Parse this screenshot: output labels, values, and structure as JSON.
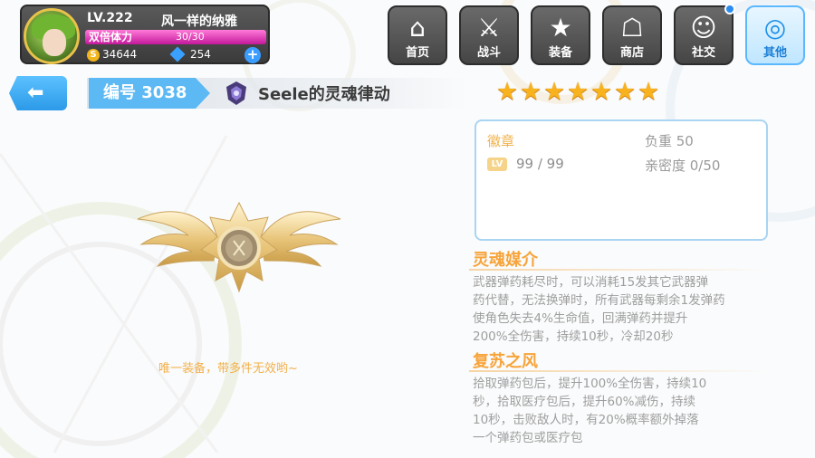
{
  "player": {
    "level": "LV.222",
    "name": "风一样的纳雅",
    "stamina_label": "双倍体力",
    "stamina_value": "30/30",
    "stamina_fraction": 1.0,
    "coins": "34644",
    "coin_symbol": "S",
    "gems": "254"
  },
  "nav": [
    {
      "label": "首页",
      "icon": "home-icon"
    },
    {
      "label": "战斗",
      "icon": "battle-icon"
    },
    {
      "label": "装备",
      "icon": "equipment-icon"
    },
    {
      "label": "商店",
      "icon": "shop-icon"
    },
    {
      "label": "社交",
      "icon": "social-icon"
    },
    {
      "label": "其他",
      "icon": "other-icon"
    }
  ],
  "header": {
    "index_label": "编号 3038",
    "item_name": "Seele的灵魂律动",
    "star_count": 7
  },
  "info": {
    "category": "徽章",
    "load": "负重 50",
    "lv_tag": "LV",
    "level": "99 / 99",
    "intimacy": "亲密度 0/50"
  },
  "skills": [
    {
      "title": "灵魂媒介",
      "lines": [
        "武器弹药耗尽时，可以消耗15发其它武器弹",
        "药代替，无法换弹时，所有武器每剩余1发弹药",
        "使角色失去4%生命值，回满弹药并提升",
        "200%全伤害，持续10秒，冷却20秒"
      ]
    },
    {
      "title": "复苏之风",
      "lines": [
        "拾取弹药包后，提升100%全伤害，持续10",
        "秒，拾取医疗包后，提升60%减伤，持续",
        "10秒，击败敌人时，有20%概率额外掉落",
        "一个弹药包或医疗包"
      ]
    }
  ],
  "note": "唯一装备，带多件无效哟~",
  "colors": {
    "accent_blue": "#5cb9f4",
    "star": "#f7b21d",
    "skill_title": "#f7a43a",
    "stamina": "#e23fb7"
  }
}
